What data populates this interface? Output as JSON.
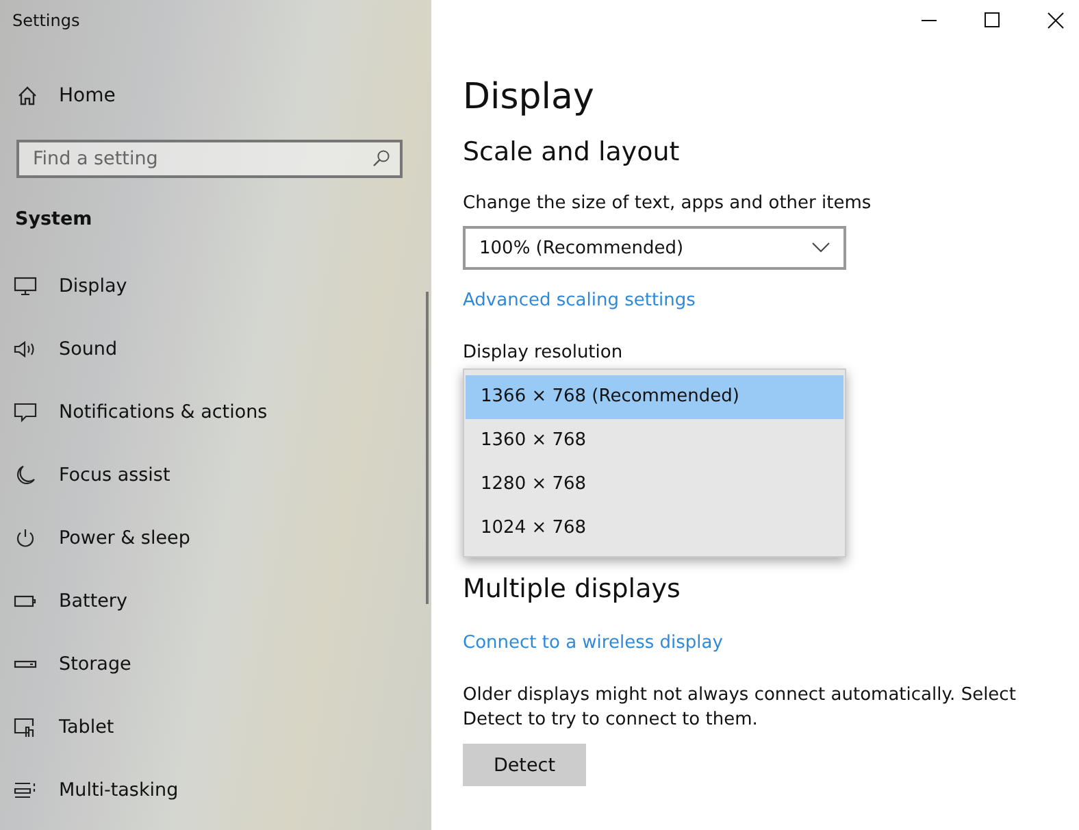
{
  "window": {
    "title": "Settings"
  },
  "sidebar": {
    "home": "Home",
    "search": {
      "placeholder": "Find a setting"
    },
    "section": "System",
    "items": [
      {
        "label": "Display"
      },
      {
        "label": "Sound"
      },
      {
        "label": "Notifications & actions"
      },
      {
        "label": "Focus assist"
      },
      {
        "label": "Power & sleep"
      },
      {
        "label": "Battery"
      },
      {
        "label": "Storage"
      },
      {
        "label": "Tablet"
      },
      {
        "label": "Multi-tasking"
      }
    ]
  },
  "content": {
    "title": "Display",
    "scale_heading": "Scale and layout",
    "scale_label": "Change the size of text, apps and other items",
    "scale_value": "100% (Recommended)",
    "scale_link": "Advanced scaling settings",
    "resolution_label": "Display resolution",
    "resolution_options": [
      {
        "label": "1366 × 768 (Recommended)",
        "selected": true
      },
      {
        "label": "1360 × 768",
        "selected": false
      },
      {
        "label": "1280 × 768",
        "selected": false
      },
      {
        "label": "1024 × 768",
        "selected": false
      }
    ],
    "multiple_heading": "Multiple displays",
    "wireless_link": "Connect to a wireless display",
    "detect_note": "Older displays might not always connect automatically. Select Detect to try to connect to them.",
    "detect_button": "Detect"
  }
}
